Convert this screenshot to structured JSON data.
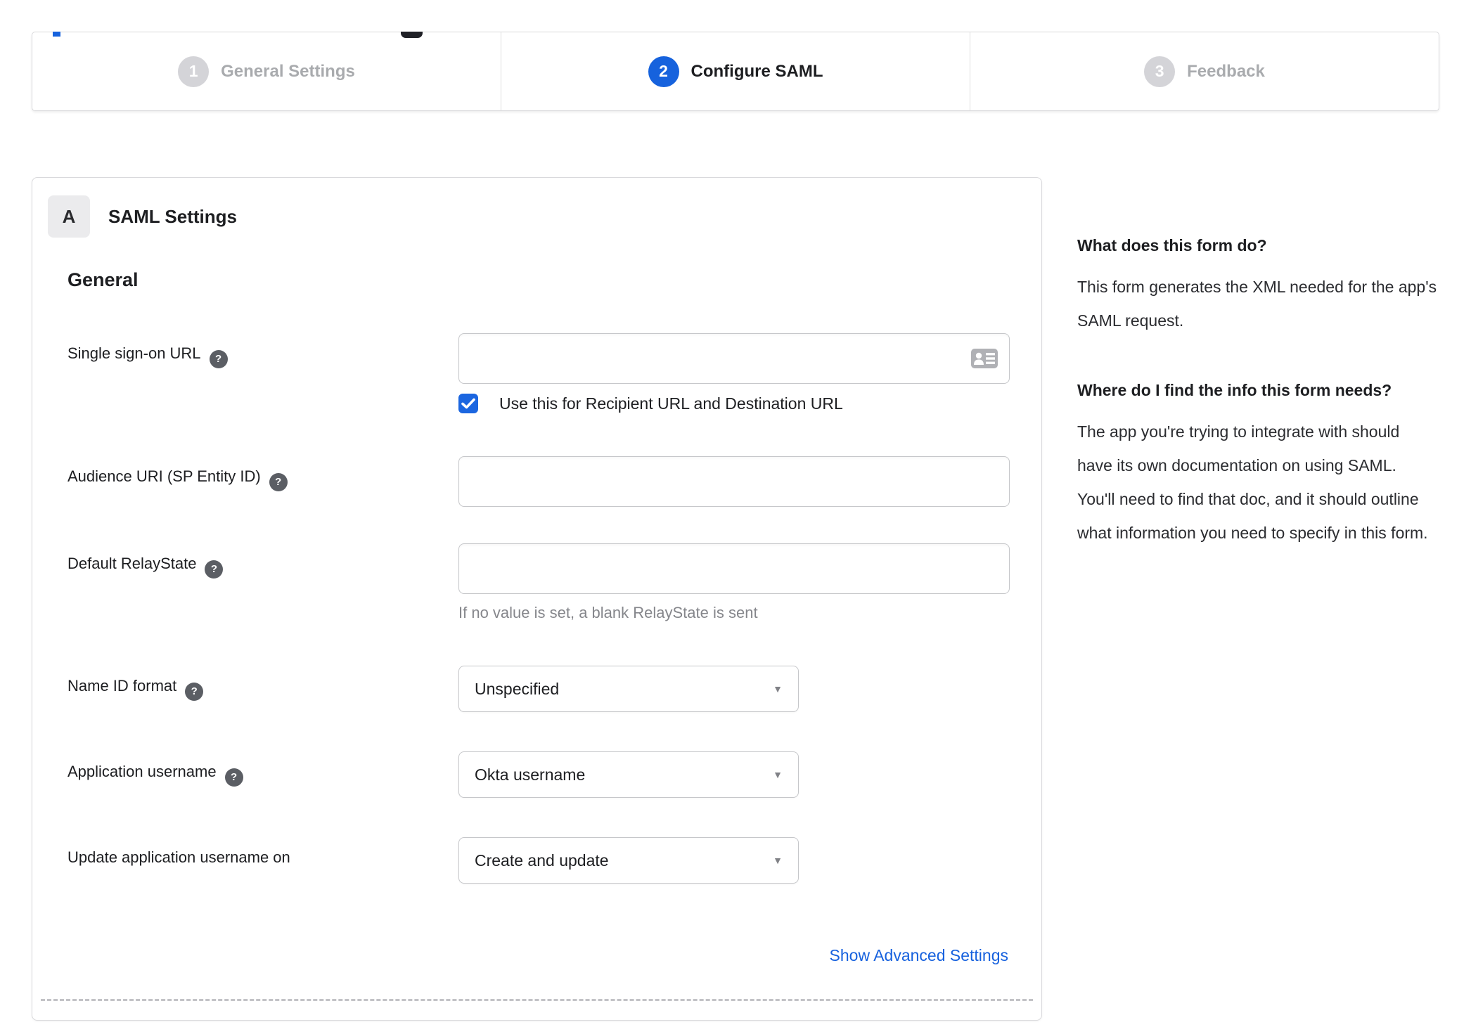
{
  "chrome_fragments": {
    "blue_tab_indicator": "cut-off blue element at top edge",
    "dark_icon_bottom": "cut-off dark icon at top edge"
  },
  "stepper": {
    "steps": [
      {
        "number": "1",
        "label": "General Settings",
        "state": "inactive"
      },
      {
        "number": "2",
        "label": "Configure SAML",
        "state": "active"
      },
      {
        "number": "3",
        "label": "Feedback",
        "state": "inactive"
      }
    ]
  },
  "panel": {
    "section_badge": "A",
    "section_title": "SAML Settings",
    "group_title": "General",
    "fields": {
      "sso_url": {
        "label": "Single sign-on URL",
        "value": "",
        "has_help_icon": true,
        "checkbox_label": "Use this for Recipient URL and Destination URL",
        "checkbox_checked": true
      },
      "audience_uri": {
        "label": "Audience URI (SP Entity ID)",
        "value": "",
        "has_help_icon": true
      },
      "default_relaystate": {
        "label": "Default RelayState",
        "value": "",
        "has_help_icon": true,
        "hint": "If no value is set, a blank RelayState is sent"
      },
      "name_id_format": {
        "label": "Name ID format",
        "selected_value": "Unspecified",
        "has_help_icon": true
      },
      "application_username": {
        "label": "Application username",
        "selected_value": "Okta username",
        "has_help_icon": true
      },
      "update_app_username": {
        "label": "Update application username on",
        "selected_value": "Create and update",
        "has_help_icon": false
      }
    },
    "advanced_link_label": "Show Advanced Settings"
  },
  "sidebar": {
    "sections": [
      {
        "heading": "What does this form do?",
        "body": "This form generates the XML needed for the app's SAML request."
      },
      {
        "heading": "Where do I find the info this form needs?",
        "body": "The app you're trying to integrate with should have its own documentation on using SAML. You'll need to find that doc, and it should outline what information you need to specify in this form."
      }
    ]
  },
  "icons": {
    "help_glyph": "?",
    "select_caret_glyph": "▼"
  },
  "colors": {
    "accent_blue": "#1662dd",
    "checkbox_blue": "#1b66e0",
    "link_blue": "#1661de",
    "inactive_step_gray": "#d4d4d8",
    "inactive_text_gray": "#a9abae",
    "dark_text": "#1d1e21",
    "hint_gray": "#85868b",
    "border_gray": "#d9d9dc"
  }
}
